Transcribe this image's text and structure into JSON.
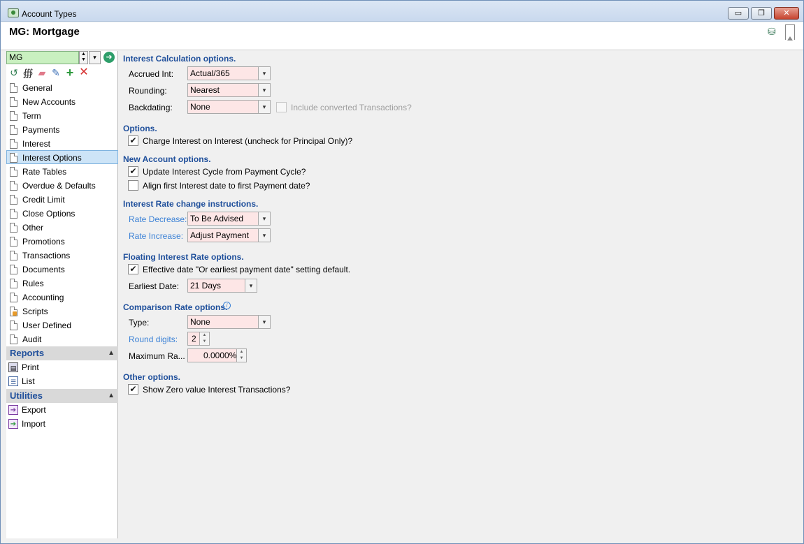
{
  "window": {
    "title": "Account Types",
    "minimize": "▭",
    "maximize": "❐",
    "close": "✕"
  },
  "header": {
    "page_title": "MG: Mortgage"
  },
  "sidebar": {
    "search_value": "MG",
    "items": [
      {
        "label": "General"
      },
      {
        "label": "New Accounts"
      },
      {
        "label": "Term"
      },
      {
        "label": "Payments"
      },
      {
        "label": "Interest"
      },
      {
        "label": "Interest Options"
      },
      {
        "label": "Rate Tables"
      },
      {
        "label": "Overdue & Defaults"
      },
      {
        "label": "Credit Limit"
      },
      {
        "label": "Close Options"
      },
      {
        "label": "Other"
      },
      {
        "label": "Promotions"
      },
      {
        "label": "Transactions"
      },
      {
        "label": "Documents"
      },
      {
        "label": "Rules"
      },
      {
        "label": "Accounting"
      },
      {
        "label": "Scripts"
      },
      {
        "label": "User Defined"
      },
      {
        "label": "Audit"
      }
    ],
    "active_index": 5,
    "reports": {
      "title": "Reports",
      "items": [
        {
          "label": "Print"
        },
        {
          "label": "List"
        }
      ]
    },
    "utilities": {
      "title": "Utilities",
      "items": [
        {
          "label": "Export"
        },
        {
          "label": "Import"
        }
      ]
    }
  },
  "main": {
    "interest_calc": {
      "title": "Interest Calculation options.",
      "accrued_label": "Accrued Int:",
      "accrued_value": "Actual/365",
      "rounding_label": "Rounding:",
      "rounding_value": "Nearest",
      "backdating_label": "Backdating:",
      "backdating_value": "None",
      "include_converted_label": "Include converted Transactions?"
    },
    "options": {
      "title": "Options.",
      "charge_interest_label": "Charge Interest on Interest (uncheck for Principal Only)?"
    },
    "new_account": {
      "title": "New Account options.",
      "update_cycle_label": "Update Interest Cycle from Payment Cycle?",
      "align_label": "Align first Interest date to first Payment date?"
    },
    "rate_change": {
      "title": "Interest Rate change instructions.",
      "decrease_label": "Rate Decrease:",
      "decrease_value": "To Be Advised",
      "increase_label": "Rate Increase:",
      "increase_value": "Adjust Payment"
    },
    "floating": {
      "title": "Floating Interest Rate options.",
      "effective_label": "Effective date \"Or earliest payment date\" setting default.",
      "earliest_label": "Earliest Date:",
      "earliest_value": "21 Days"
    },
    "comparison": {
      "title": "Comparison Rate options.",
      "type_label": "Type:",
      "type_value": "None",
      "round_label": "Round digits:",
      "round_value": "2",
      "max_label": "Maximum Ra...",
      "max_value": "0.0000%"
    },
    "other": {
      "title": "Other options.",
      "show_zero_label": "Show Zero value Interest Transactions?"
    }
  },
  "check_mark": "✔"
}
